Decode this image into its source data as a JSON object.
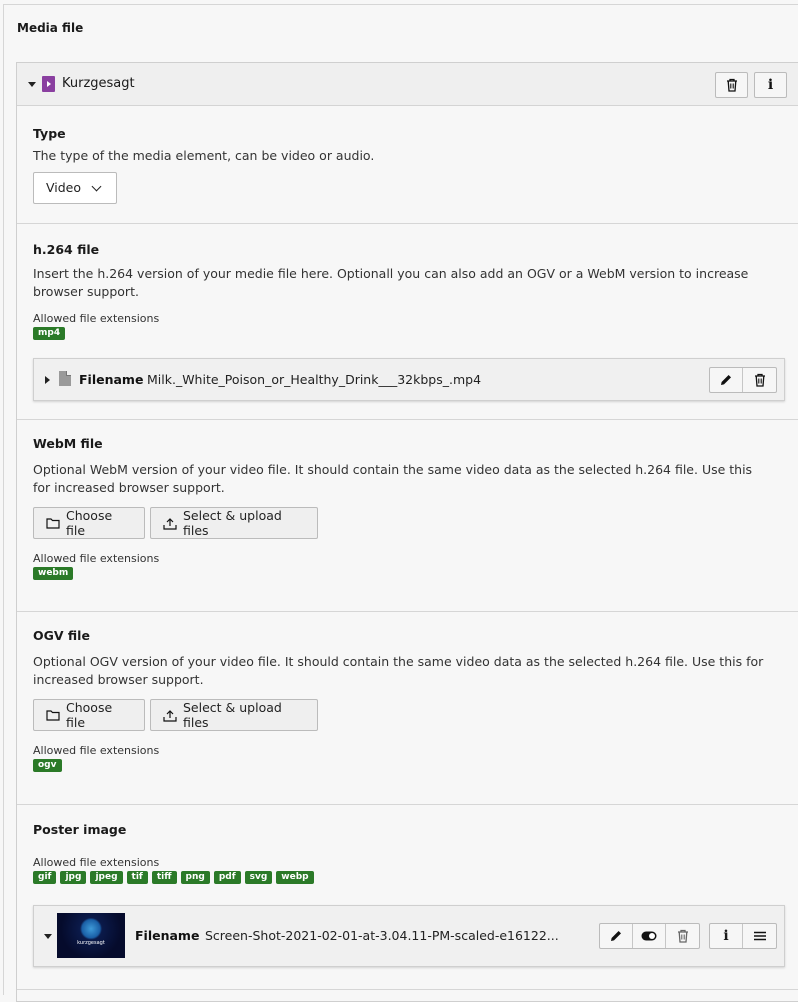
{
  "section_title": "Media file",
  "panel": {
    "title": "Kurzgesagt",
    "delete_icon": "trash-icon",
    "info_icon": "info-icon",
    "file_type_icon": "video-file-icon"
  },
  "type_field": {
    "title": "Type",
    "description": "The type of the media element, can be video or audio.",
    "selected": "Video"
  },
  "h264_field": {
    "title": "h.264 file",
    "description": "Insert the h.264 version of your medie file here. Optionall you can also add an OGV or a WebM version to increase browser support.",
    "allowed_label": "Allowed file extensions",
    "extensions": [
      "mp4"
    ],
    "file": {
      "label": "Filename",
      "name": "Milk._White_Poison_or_Healthy_Drink___32kbps_.mp4"
    }
  },
  "webm_field": {
    "title": "WebM file",
    "description": "Optional WebM version of your video file. It should contain the same video data as the selected h.264 file. Use this for increased browser support.",
    "choose_label": "Choose file",
    "upload_label": "Select & upload files",
    "allowed_label": "Allowed file extensions",
    "extensions": [
      "webm"
    ]
  },
  "ogv_field": {
    "title": "OGV file",
    "description": "Optional OGV version of your video file. It should contain the same video data as the selected h.264 file. Use this for increased browser support.",
    "choose_label": "Choose file",
    "upload_label": "Select & upload files",
    "allowed_label": "Allowed file extensions",
    "extensions": [
      "ogv"
    ]
  },
  "poster_field": {
    "title": "Poster image",
    "allowed_label": "Allowed file extensions",
    "extensions": [
      "gif",
      "jpg",
      "jpeg",
      "tif",
      "tiff",
      "png",
      "pdf",
      "svg",
      "webp"
    ],
    "file": {
      "label": "Filename",
      "name": "Screen-Shot-2021-02-01-at-3.04.11-PM-scaled-e16122...",
      "thumb_text": "kurzgesagt"
    }
  },
  "colors": {
    "extension_badge": "#2b7a28",
    "video_icon": "#8a3fa0"
  }
}
